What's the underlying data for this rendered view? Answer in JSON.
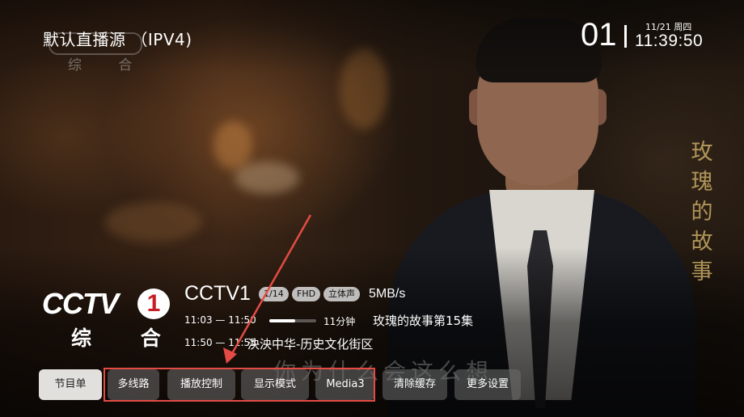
{
  "source": {
    "title": "默认直播源 （IPV4)"
  },
  "watermark": {
    "logo_text": "综 合",
    "show_title": "玫瑰的故事"
  },
  "channel": {
    "number": "01",
    "name": "CCTV1",
    "logo_text": "CCTV",
    "logo_number": "1",
    "logo_sub": "综 合",
    "tags": [
      "1/14",
      "FHD",
      "立体声"
    ],
    "speed": "5MB/s"
  },
  "clock": {
    "date": "11/21 周四",
    "time": "11:39:50"
  },
  "programs": [
    {
      "time": "11:03 — 11:50",
      "progress": 0.55,
      "remaining": "11分钟",
      "title": "玫瑰的故事第15集"
    },
    {
      "time": "11:50 — 11:55",
      "title": "泱泱中华-历史文化街区"
    }
  ],
  "subtitle": "你为什么会这么想",
  "menu": [
    {
      "label": "节目单",
      "active": true
    },
    {
      "label": "多线路"
    },
    {
      "label": "播放控制"
    },
    {
      "label": "显示模式"
    },
    {
      "label": "Media3"
    },
    {
      "label": "清除缓存"
    },
    {
      "label": "更多设置"
    }
  ],
  "annotation_color": "#e44b44"
}
